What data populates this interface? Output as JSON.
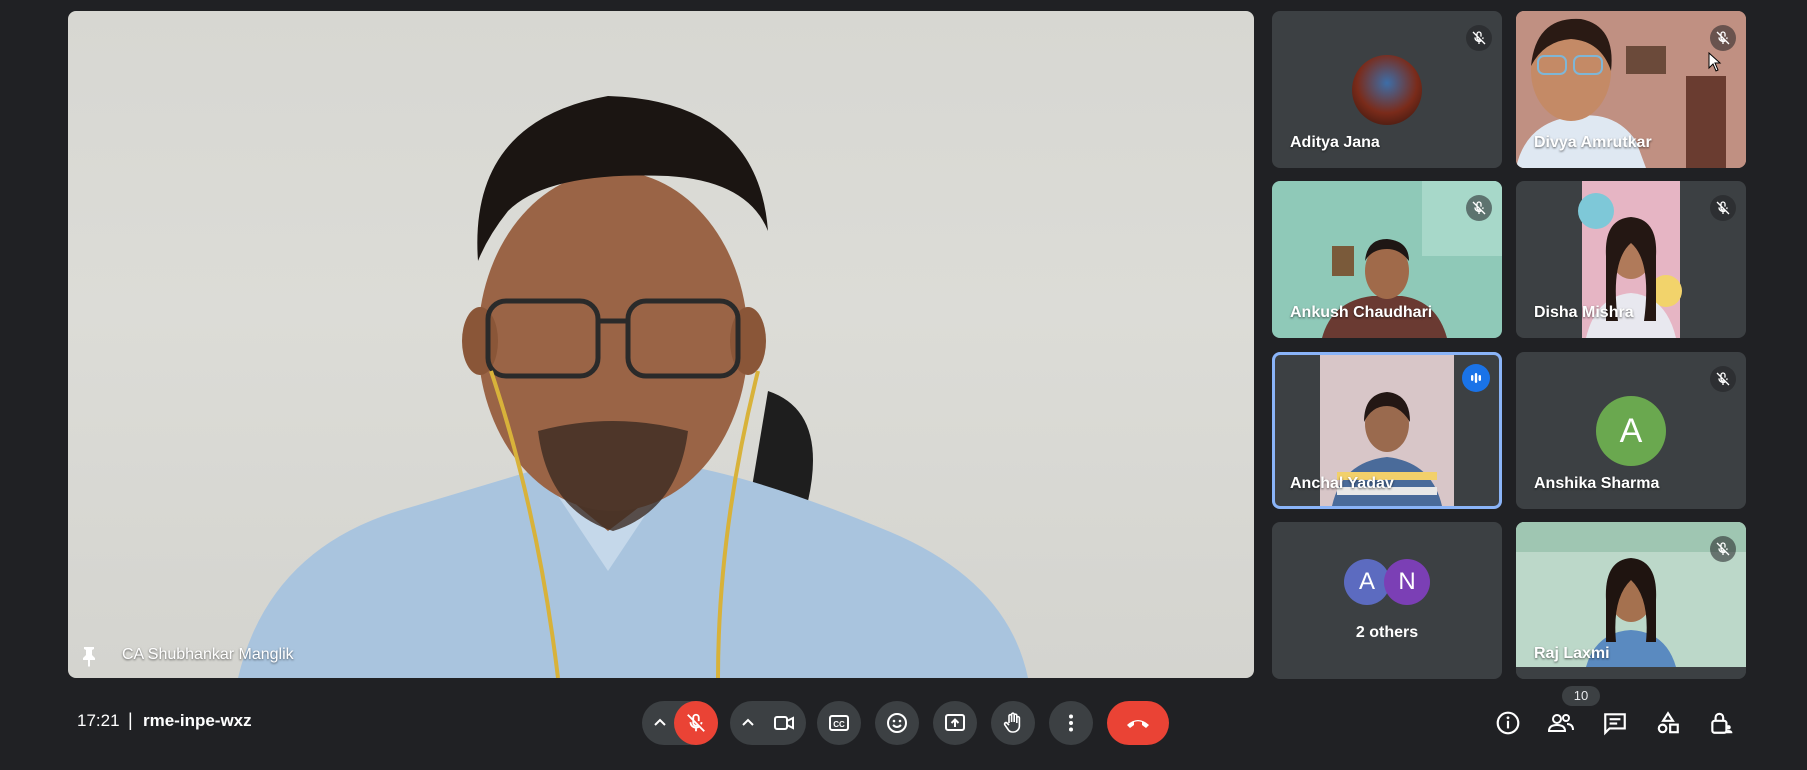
{
  "main_speaker": {
    "name": "CA Shubhankar Manglik"
  },
  "participants": [
    {
      "name": "Aditya Jana"
    },
    {
      "name": "Divya Amrutkar"
    },
    {
      "name": "Ankush Chaudhari"
    },
    {
      "name": "Disha Mishra"
    },
    {
      "name": "Anchal Yadav"
    },
    {
      "name": "Anshika Sharma",
      "avatar_letter": "A",
      "avatar_color": "#6aa84f"
    },
    {
      "others_label": "2 others",
      "avatars": [
        {
          "letter": "A",
          "color": "#5c6bc0"
        },
        {
          "letter": "N",
          "color": "#7b3fb5"
        }
      ]
    },
    {
      "name": "Raj Laxmi"
    }
  ],
  "meeting": {
    "time": "17:21",
    "separator": "|",
    "code": "rme-inpe-wxz"
  },
  "people_count": "10",
  "colors": {
    "end_call": "#ea4335",
    "speaking_border": "#8ab4f8",
    "mic_off": "#ea4335"
  }
}
